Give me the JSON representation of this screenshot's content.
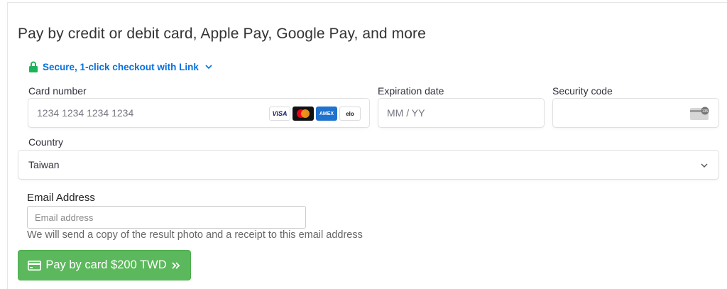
{
  "heading": "Pay by credit or debit card, Apple Pay, Google Pay, and more",
  "link": {
    "label": "Secure, 1-click checkout with Link",
    "accent": "#0570de",
    "lock_color": "#1db35b"
  },
  "card_number": {
    "label": "Card number",
    "placeholder": "1234 1234 1234 1234",
    "brands": [
      "VISA",
      "mastercard",
      "AMEX",
      "elo"
    ]
  },
  "expiration": {
    "label": "Expiration date",
    "placeholder": "MM / YY"
  },
  "security": {
    "label": "Security code",
    "icon_text": "135"
  },
  "country": {
    "label": "Country",
    "value": "Taiwan"
  },
  "email": {
    "label": "Email Address",
    "placeholder": "Email address",
    "help": "We will send a copy of the result photo and a receipt to this email address"
  },
  "pay_button": {
    "label": "Pay by card $200 TWD",
    "color": "#5cb85c"
  }
}
